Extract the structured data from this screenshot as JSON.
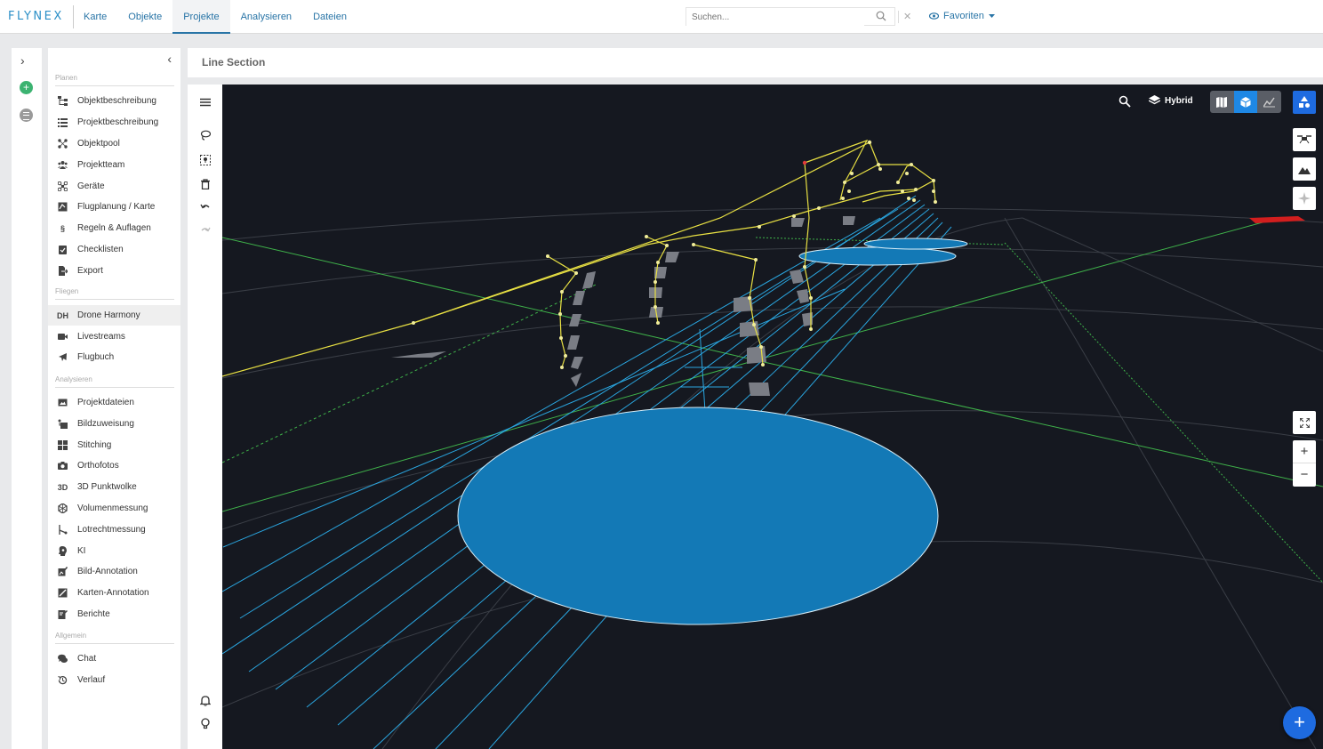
{
  "app": {
    "logo": "FLYNEX",
    "nav": [
      {
        "label": "Karte"
      },
      {
        "label": "Objekte"
      },
      {
        "label": "Projekte"
      },
      {
        "label": "Analysieren"
      },
      {
        "label": "Dateien"
      }
    ],
    "active_nav": "Projekte",
    "search": {
      "placeholder": "Suchen..."
    },
    "favorites_label": "Favoriten"
  },
  "sidebar": {
    "sections": [
      {
        "title": "Planen",
        "items": [
          {
            "label": "Objektbeschreibung",
            "icon": "hierarchy-icon"
          },
          {
            "label": "Projektbeschreibung",
            "icon": "list-icon"
          },
          {
            "label": "Objektpool",
            "icon": "nodes-icon"
          },
          {
            "label": "Projektteam",
            "icon": "team-icon"
          },
          {
            "label": "Geräte",
            "icon": "drone-icon"
          },
          {
            "label": "Flugplanung / Karte",
            "icon": "map-plan-icon"
          },
          {
            "label": "Regeln & Auflagen",
            "icon": "paragraph-icon",
            "glyph": "§"
          },
          {
            "label": "Checklisten",
            "icon": "checklist-icon"
          },
          {
            "label": "Export",
            "icon": "export-icon"
          }
        ]
      },
      {
        "title": "Fliegen",
        "items": [
          {
            "label": "Drone Harmony",
            "icon": "dh-icon",
            "glyph": "DH",
            "active": true
          },
          {
            "label": "Livestreams",
            "icon": "livestream-icon"
          },
          {
            "label": "Flugbuch",
            "icon": "plane-icon"
          }
        ]
      },
      {
        "title": "Analysieren",
        "items": [
          {
            "label": "Projektdateien",
            "icon": "image-file-icon"
          },
          {
            "label": "Bildzuweisung",
            "icon": "image-assign-icon"
          },
          {
            "label": "Stitching",
            "icon": "grid-icon"
          },
          {
            "label": "Orthofotos",
            "icon": "camera-icon"
          },
          {
            "label": "3D Punktwolke",
            "icon": "3d-icon",
            "glyph": "3D"
          },
          {
            "label": "Volumenmessung",
            "icon": "volume-icon"
          },
          {
            "label": "Lotrechtmessung",
            "icon": "plumb-icon"
          },
          {
            "label": "KI",
            "icon": "ai-head-icon"
          },
          {
            "label": "Bild-Annotation",
            "icon": "image-annotate-icon"
          },
          {
            "label": "Karten-Annotation",
            "icon": "map-annotate-icon"
          },
          {
            "label": "Berichte",
            "icon": "report-icon"
          }
        ]
      },
      {
        "title": "Allgemein",
        "items": [
          {
            "label": "Chat",
            "icon": "chat-icon"
          },
          {
            "label": "Verlauf",
            "icon": "history-icon"
          }
        ]
      }
    ]
  },
  "main": {
    "title": "Line Section",
    "viewport": {
      "layer_label": "Hybrid",
      "view_modes": [
        "map",
        "3d",
        "terrain"
      ],
      "active_view": "3d",
      "accent": "#1e88e5",
      "background": "#151820"
    }
  }
}
